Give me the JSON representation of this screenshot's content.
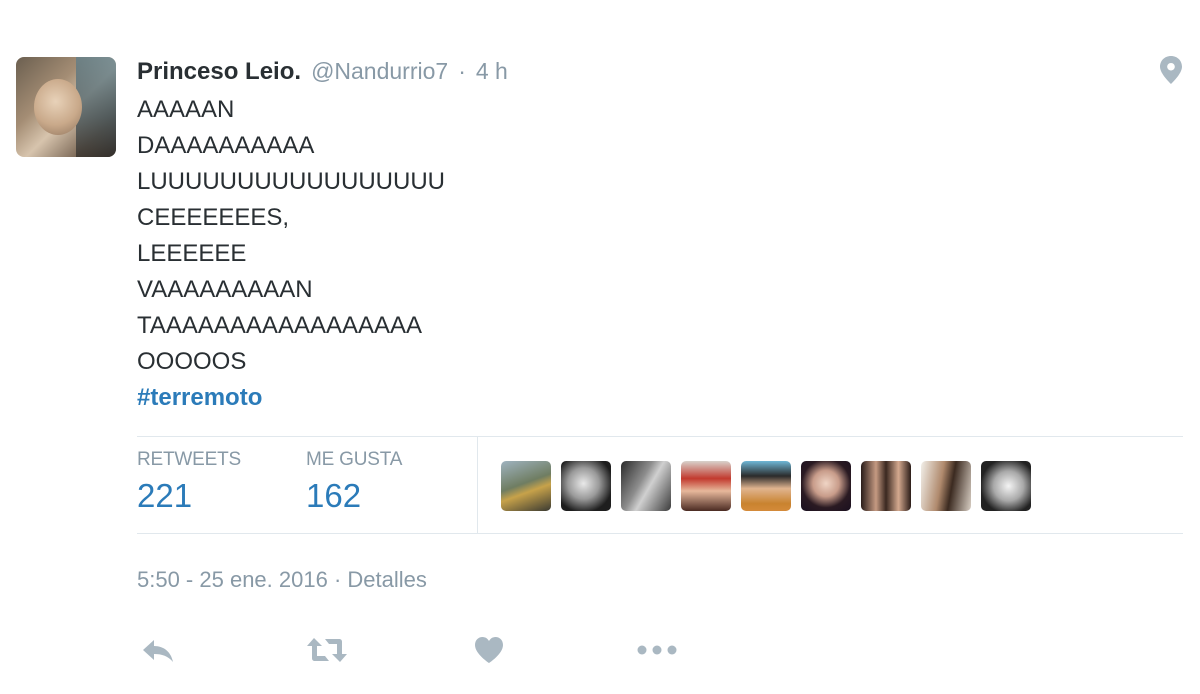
{
  "tweet": {
    "author_name": "Princeso Leio.",
    "handle": "@Nandurrio7",
    "separator": "·",
    "time_ago": "4 h",
    "lines": [
      "AAAAAN",
      "DAAAAAAAAAA",
      "LUUUUUUUUUUUUUUUUU",
      "CEEEEEEES,",
      "LEEEEEE",
      "VAAAAAAAAAN",
      "TAAAAAAAAAAAAAAAAA",
      "OOOOOS"
    ],
    "hashtag": "#terremoto"
  },
  "stats": {
    "retweets_label": "RETWEETS",
    "retweets_value": "221",
    "likes_label": "ME GUSTA",
    "likes_value": "162"
  },
  "likers_count_shown": 9,
  "timestamp": {
    "datetime": "5:50 - 25 ene. 2016",
    "separator": "·",
    "details_link": "Detalles"
  },
  "icons": {
    "location": "map-pin-icon",
    "reply": "reply-icon",
    "retweet": "retweet-icon",
    "like": "heart-icon",
    "more": "more-icon"
  },
  "colors": {
    "text": "#292f33",
    "muted": "#8899a6",
    "link": "#2b7bb9",
    "divider": "#e1e8ed",
    "icon": "#aab8c2"
  }
}
